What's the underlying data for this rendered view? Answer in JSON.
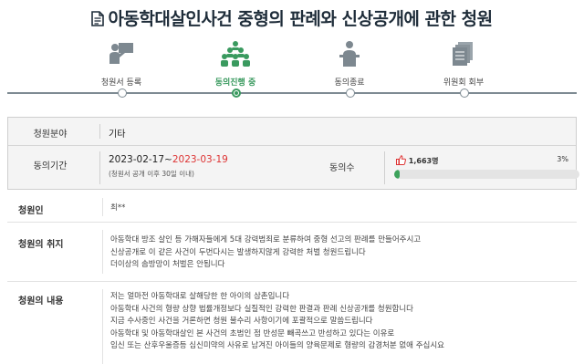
{
  "page": {
    "title": "아동학대살인사건 중형의 판례와 신상공개에 관한 청원"
  },
  "steps": [
    {
      "label": "청원서 등록",
      "icon": "presenter-icon",
      "active": false
    },
    {
      "label": "동의진행 중",
      "icon": "people-group-icon",
      "active": true
    },
    {
      "label": "동의종료",
      "icon": "podium-speaker-icon",
      "active": false
    },
    {
      "label": "위원회 회부",
      "icon": "document-stack-icon",
      "active": false
    }
  ],
  "info": {
    "field_label": "청원분야",
    "field_value": "기타",
    "period_label": "동의기간",
    "period_start": "2023-02-17~",
    "period_end": "2023-03-19",
    "period_note": "(청원서 공개 이후 30일 이내)",
    "agree_label": "동의수",
    "agree_count": "1,663명",
    "agree_percent": "3%",
    "agree_progress": 0.03,
    "accent_color": "#3da25b"
  },
  "petitioner": {
    "label": "청원인",
    "value": "최**"
  },
  "purpose": {
    "label": "청원의 취지",
    "lines": [
      "아동학대 방조 살인 등 가해자들에게 5대 강력범죄로 분류하여 중형 선고의 판례를 만들어주시고",
      "신상공개로 이 같은 사건이 두번다시는 발생하지않게 강력한 처벌 청원드립니다",
      "더이상의 솜방망이 처벌은 안됩니다"
    ]
  },
  "body": {
    "label": "청원의 내용",
    "lines": [
      "저는 얼마전 아동학대로 살해당한 한 아이의 삼촌입니다",
      "아동학대 사건의 형량 상향 법률개정보다 실질적인 강력한 판결과 판례 신상공개를 청원합니다",
      "지금 수사중인 사건을 거론하면 청원 불수리 사항이기에 포괄적으로 말씀드립니다",
      "아동학대 및 아동학대살인  본 사건의 초범인 점 반성문 빼곡쓰고 반성하고 있다는 이유로",
      "임신 또는 산후우울증등 심신미약의 사유로 남겨진 아이들의 양육문제로 형량의 감경처분 없애 주십시요"
    ]
  }
}
